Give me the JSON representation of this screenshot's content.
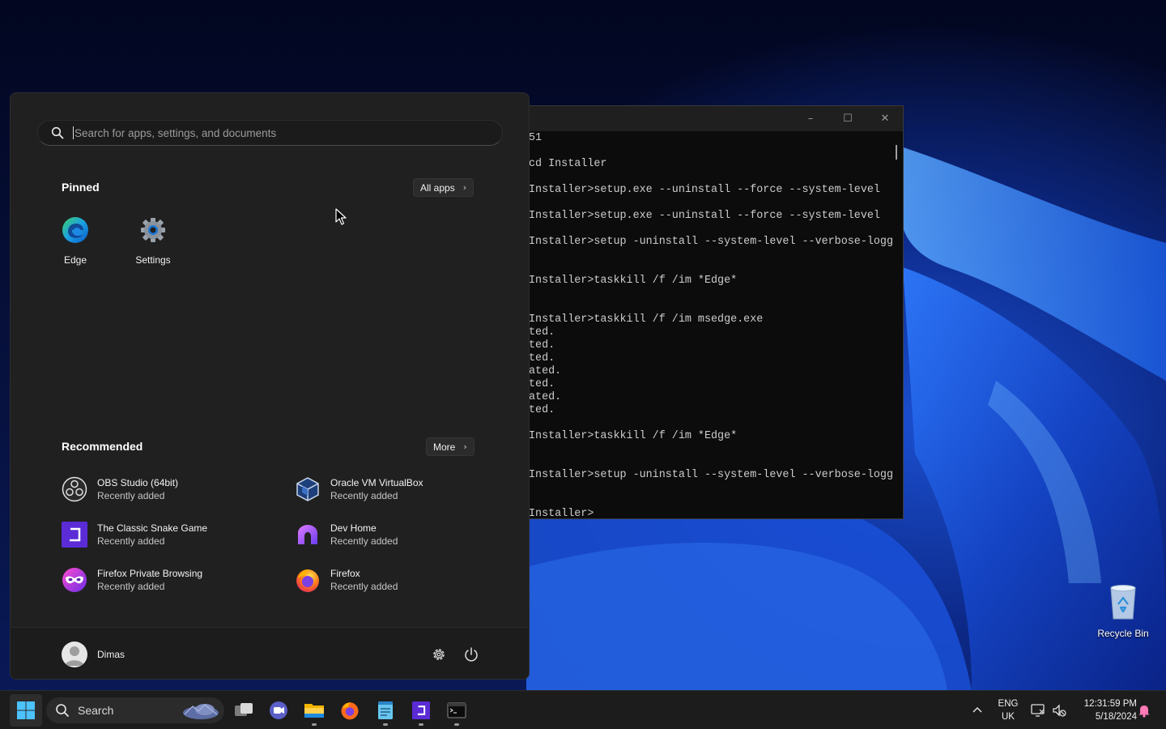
{
  "desktop": {
    "recycle_bin_label": "Recycle Bin"
  },
  "console": {
    "lines": [
      "51",
      "",
      "cd Installer",
      "",
      "Installer>setup.exe --uninstall --force --system-level",
      "",
      "Installer>setup.exe --uninstall --force --system-level",
      "",
      "Installer>setup -uninstall --system-level --verbose-logg",
      "",
      "",
      "Installer>taskkill /f /im *Edge*",
      "",
      "",
      "Installer>taskkill /f /im msedge.exe",
      "ted.",
      "ted.",
      "ted.",
      "ated.",
      "ted.",
      "ated.",
      "ted.",
      "",
      "Installer>taskkill /f /im *Edge*",
      "",
      "",
      "Installer>setup -uninstall --system-level --verbose-logg",
      "",
      "",
      "Installer>"
    ]
  },
  "start_menu": {
    "search_placeholder": "Search for apps, settings, and documents",
    "pinned_title": "Pinned",
    "all_apps_label": "All apps",
    "pinned": [
      {
        "label": "Edge",
        "icon": "edge-icon"
      },
      {
        "label": "Settings",
        "icon": "settings-gear-icon"
      }
    ],
    "recommended_title": "Recommended",
    "more_label": "More",
    "recommended": [
      {
        "name": "OBS Studio (64bit)",
        "sub": "Recently added",
        "icon": "obs-icon"
      },
      {
        "name": "Oracle VM VirtualBox",
        "sub": "Recently added",
        "icon": "virtualbox-icon"
      },
      {
        "name": "The Classic Snake Game",
        "sub": "Recently added",
        "icon": "snake-game-icon"
      },
      {
        "name": "Dev Home",
        "sub": "Recently added",
        "icon": "dev-home-icon"
      },
      {
        "name": "Firefox Private Browsing",
        "sub": "Recently added",
        "icon": "firefox-private-icon"
      },
      {
        "name": "Firefox",
        "sub": "Recently added",
        "icon": "firefox-icon"
      }
    ],
    "user_name": "Dimas"
  },
  "taskbar": {
    "search_label": "Search",
    "language": "ENG",
    "region": "UK",
    "time": "12:31:59 PM",
    "date": "5/18/2024"
  },
  "colors": {
    "accent": "#0078d4",
    "start_bg": "#202020",
    "taskbar_bg": "#1c1c1c"
  }
}
